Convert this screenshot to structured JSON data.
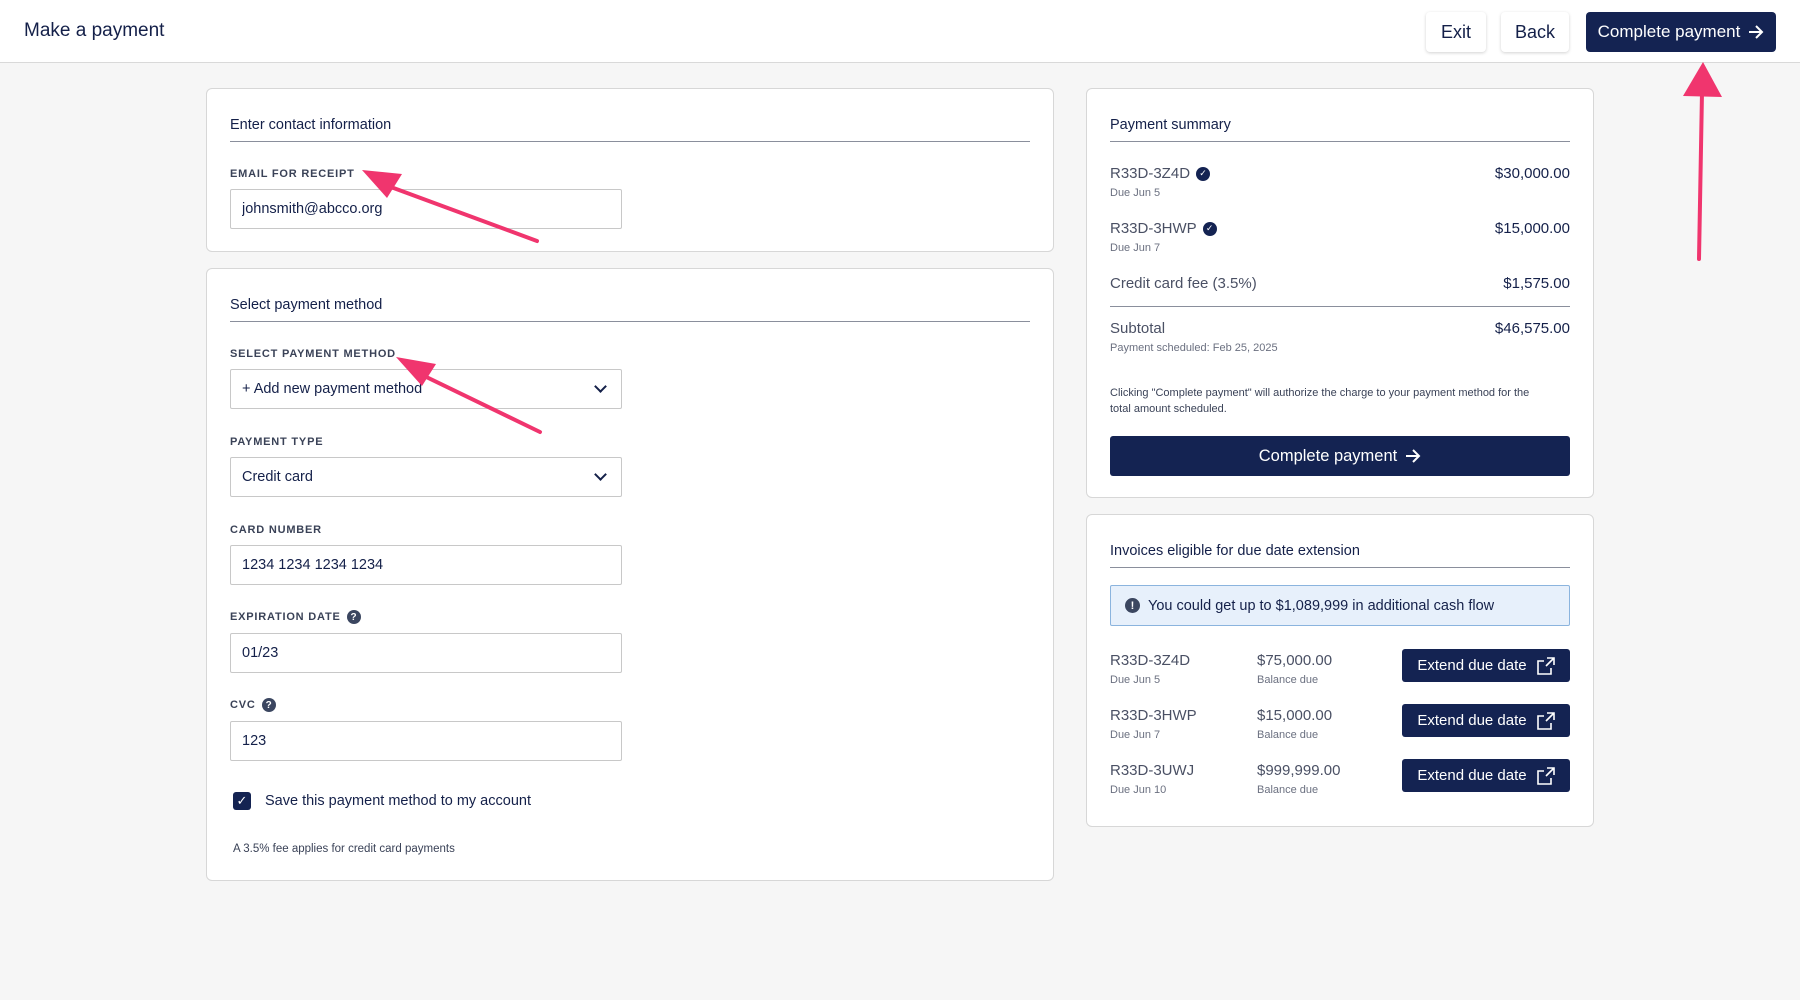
{
  "header": {
    "title": "Make a payment",
    "exit_label": "Exit",
    "back_label": "Back",
    "complete_label": "Complete payment"
  },
  "contact": {
    "heading": "Enter contact information",
    "email_label": "EMAIL FOR RECEIPT",
    "email_value": "johnsmith@abcco.org"
  },
  "payment_method": {
    "heading": "Select payment method",
    "method_label": "SELECT PAYMENT METHOD",
    "method_value": "+ Add new payment method",
    "type_label": "PAYMENT TYPE",
    "type_value": "Credit card",
    "card_label": "CARD NUMBER",
    "card_value": "1234 1234 1234 1234",
    "exp_label": "EXPIRATION DATE",
    "exp_value": "01/23",
    "cvc_label": "CVC",
    "cvc_value": "123",
    "save_label": "Save this payment method to my account",
    "save_checked": true,
    "fee_note": "A 3.5% fee applies for credit card payments"
  },
  "summary": {
    "heading": "Payment summary",
    "items": [
      {
        "id": "R33D-3Z4D",
        "due": "Due Jun 5",
        "amount": "$30,000.00",
        "verified": true
      },
      {
        "id": "R33D-3HWP",
        "due": "Due Jun 7",
        "amount": "$15,000.00",
        "verified": true
      }
    ],
    "fee_label": "Credit card fee (3.5%)",
    "fee_amount": "$1,575.00",
    "subtotal_label": "Subtotal",
    "subtotal_note": "Payment scheduled: Feb 25, 2025",
    "subtotal_amount": "$46,575.00",
    "disclaimer": "Clicking \"Complete payment\" will authorize the charge to your payment method for the total amount scheduled.",
    "button_label": "Complete payment"
  },
  "extension": {
    "heading": "Invoices eligible for due date extension",
    "banner": "You could get up to $1,089,999 in additional cash flow",
    "invoices": [
      {
        "id": "R33D-3Z4D",
        "due": "Due Jun 5",
        "amount": "$75,000.00",
        "balance_label": "Balance due",
        "button": "Extend due date"
      },
      {
        "id": "R33D-3HWP",
        "due": "Due Jun 7",
        "amount": "$15,000.00",
        "balance_label": "Balance due",
        "button": "Extend due date"
      },
      {
        "id": "R33D-3UWJ",
        "due": "Due Jun 10",
        "amount": "$999,999.00",
        "balance_label": "Balance due",
        "button": "Extend due date"
      }
    ]
  },
  "colors": {
    "primary": "#142352",
    "annotation_arrow": "#f0356e",
    "banner_bg": "#e7f0fb"
  }
}
